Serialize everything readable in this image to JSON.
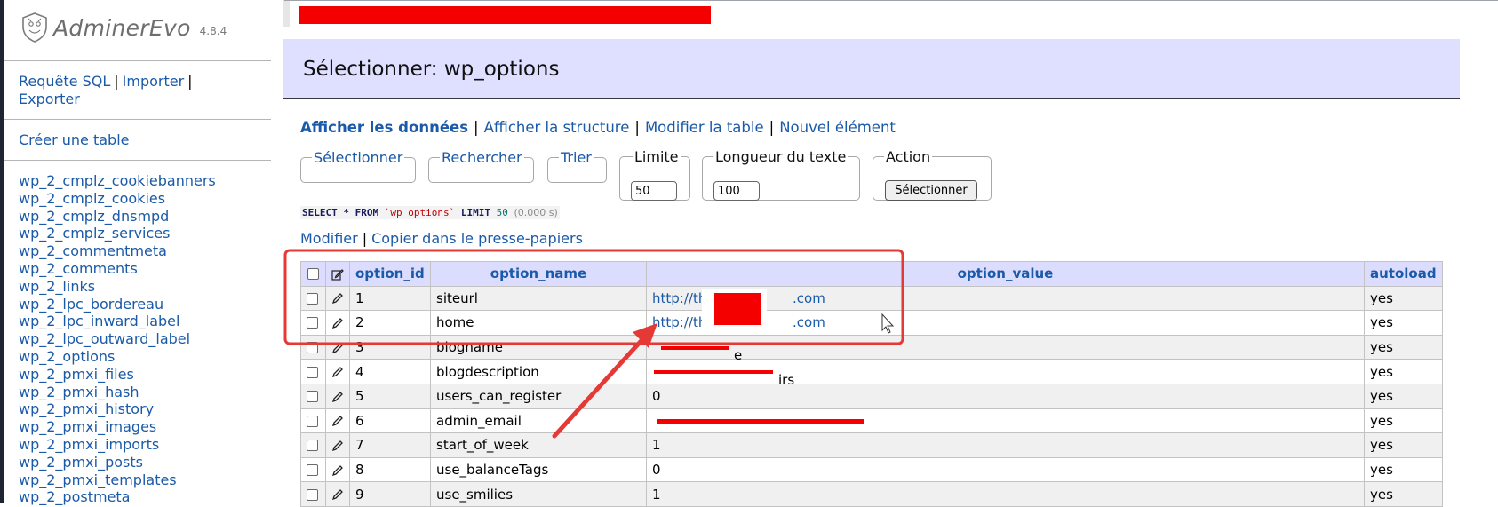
{
  "app": {
    "name": "AdminerEvo",
    "version": "4.8.4"
  },
  "sidebar": {
    "links": [
      "Requête SQL",
      "Importer",
      "Exporter"
    ],
    "create_table": "Créer une table",
    "tables": [
      "wp_2_cmplz_cookiebanners",
      "wp_2_cmplz_cookies",
      "wp_2_cmplz_dnsmpd",
      "wp_2_cmplz_services",
      "wp_2_commentmeta",
      "wp_2_comments",
      "wp_2_links",
      "wp_2_lpc_bordereau",
      "wp_2_lpc_inward_label",
      "wp_2_lpc_outward_label",
      "wp_2_options",
      "wp_2_pmxi_files",
      "wp_2_pmxi_hash",
      "wp_2_pmxi_history",
      "wp_2_pmxi_images",
      "wp_2_pmxi_imports",
      "wp_2_pmxi_posts",
      "wp_2_pmxi_templates",
      "wp_2_postmeta"
    ]
  },
  "page": {
    "title": "Sélectionner: wp_options"
  },
  "nav": {
    "show_data": "Afficher les données",
    "show_structure": "Afficher la structure",
    "alter_table": "Modifier la table",
    "new_item": "Nouvel élément"
  },
  "form": {
    "select_legend": "Sélectionner",
    "search_legend": "Rechercher",
    "sort_legend": "Trier",
    "limit_legend": "Limite",
    "limit_value": "50",
    "text_length_legend": "Longueur du texte",
    "text_length_value": "100",
    "action_legend": "Action",
    "action_button": "Sélectionner"
  },
  "query": {
    "select": "SELECT",
    "star": "*",
    "from": "FROM",
    "table": "`wp_options`",
    "limit": "LIMIT",
    "limit_num": "50",
    "time": "(0.000 s)"
  },
  "actions": {
    "edit": "Modifier",
    "copy": "Copier dans le presse-papiers"
  },
  "table": {
    "headers": [
      "option_id",
      "option_name",
      "option_value",
      "autoload"
    ],
    "rows": [
      {
        "id": "1",
        "name": "siteurl",
        "value_a": "http://the",
        "value_b": ".com",
        "autoload": "yes"
      },
      {
        "id": "2",
        "name": "home",
        "value_a": "http://the",
        "value_b": ".com",
        "autoload": "yes"
      },
      {
        "id": "3",
        "name": "blogname",
        "value_a": "",
        "value_b": "e",
        "autoload": "yes"
      },
      {
        "id": "4",
        "name": "blogdescription",
        "value_a": "",
        "value_b": "irs",
        "autoload": "yes"
      },
      {
        "id": "5",
        "name": "users_can_register",
        "value_a": "0",
        "value_b": "",
        "autoload": "yes"
      },
      {
        "id": "6",
        "name": "admin_email",
        "value_a": "",
        "value_b": "",
        "autoload": "yes"
      },
      {
        "id": "7",
        "name": "start_of_week",
        "value_a": "1",
        "value_b": "",
        "autoload": "yes"
      },
      {
        "id": "8",
        "name": "use_balanceTags",
        "value_a": "0",
        "value_b": "",
        "autoload": "yes"
      },
      {
        "id": "9",
        "name": "use_smilies",
        "value_a": "1",
        "value_b": "",
        "autoload": "yes"
      }
    ]
  },
  "colors": {
    "accent_link": "#1a5aa8",
    "header_band": "#dfe0ff",
    "annotation_red": "#e53935"
  }
}
